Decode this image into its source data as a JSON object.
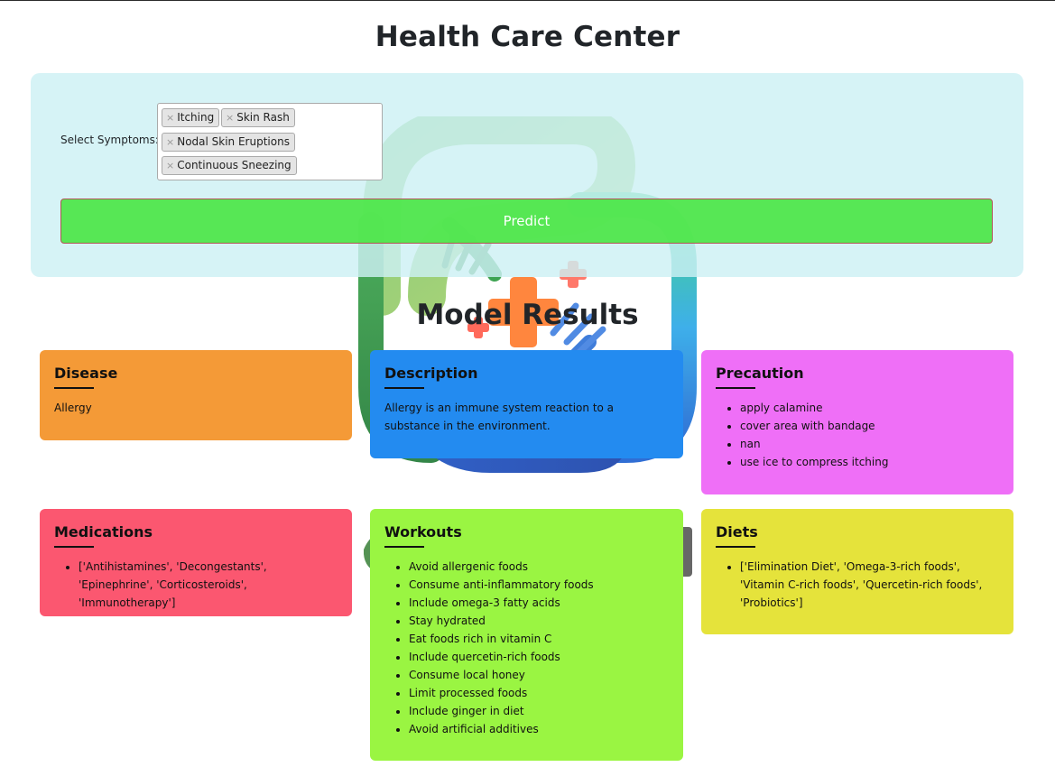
{
  "header": {
    "title": "Health Care Center"
  },
  "form": {
    "symptoms_label": "Select Symptoms:",
    "remove_glyph": "×",
    "selected_symptoms": [
      "Itching",
      "Skin Rash",
      "Nodal Skin Eruptions",
      "Continuous Sneezing"
    ],
    "predict_label": "Predict"
  },
  "results": {
    "title": "Model Results",
    "disease": {
      "heading": "Disease",
      "value": "Allergy"
    },
    "description": {
      "heading": "Description",
      "value": "Allergy is an immune system reaction to a substance in the environment."
    },
    "precaution": {
      "heading": "Precaution",
      "items": [
        "apply calamine",
        "cover area with bandage",
        "nan",
        "use ice to compress itching"
      ]
    },
    "medications": {
      "heading": "Medications",
      "items": [
        "['Antihistamines', 'Decongestants', 'Epinephrine', 'Corticosteroids', 'Immunotherapy']"
      ]
    },
    "workouts": {
      "heading": "Workouts",
      "items": [
        "Avoid allergenic foods",
        "Consume anti-inflammatory foods",
        "Include omega-3 fatty acids",
        "Stay hydrated",
        "Eat foods rich in vitamin C",
        "Include quercetin-rich foods",
        "Consume local honey",
        "Limit processed foods",
        "Include ginger in diet",
        "Avoid artificial additives"
      ]
    },
    "diets": {
      "heading": "Diets",
      "items": [
        "['Elimination Diet', 'Omega-3-rich foods', 'Vitamin C-rich foods', 'Quercetin-rich foods', 'Probiotics']"
      ]
    }
  },
  "colors": {
    "disease": "#f49a37",
    "description": "#238bf0",
    "precaution": "#ef6ff7",
    "medications": "#fb5770",
    "workouts": "#9af542",
    "diets": "#e5e33b",
    "predict": "#4ce646",
    "panel": "#cdf0f4"
  },
  "icons": {
    "background_logo": "healthcare-logo-icon",
    "chip_remove": "close-icon"
  }
}
